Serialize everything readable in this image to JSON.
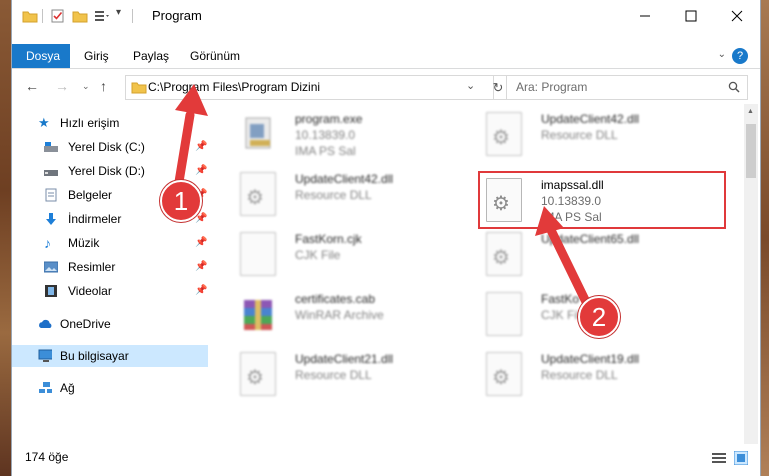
{
  "window": {
    "title": "Program"
  },
  "ribbon": {
    "tabs": [
      "Dosya",
      "Giriş",
      "Paylaş",
      "Görünüm"
    ]
  },
  "nav": {
    "address": "C:\\Program Files\\Program Dizini",
    "search_placeholder": "Ara: Program"
  },
  "sidebar": {
    "items": [
      {
        "label": "Hızlı erişim"
      },
      {
        "label": "Yerel Disk (C:)"
      },
      {
        "label": "Yerel Disk (D:)"
      },
      {
        "label": "Belgeler"
      },
      {
        "label": "İndirmeler"
      },
      {
        "label": "Müzik"
      },
      {
        "label": "Resimler"
      },
      {
        "label": "Videolar"
      },
      {
        "label": "OneDrive"
      },
      {
        "label": "Bu bilgisayar"
      },
      {
        "label": "Ağ"
      }
    ]
  },
  "files": [
    {
      "name": "program.exe",
      "line2": "10.13839.0",
      "line3": "IMA PS Sal"
    },
    {
      "name": "UpdateClient42.dll",
      "line2": "Resource DLL",
      "line3": ""
    },
    {
      "name": "UpdateClient42.dll",
      "line2": "Resource DLL",
      "line3": ""
    },
    {
      "name": "imapssal.dll",
      "line2": "10.13839.0",
      "line3": "IMA PS Sal"
    },
    {
      "name": "FastKorn.cjk",
      "line2": "CJK File",
      "line3": ""
    },
    {
      "name": "UpdateClient65.dll",
      "line2": "",
      "line3": ""
    },
    {
      "name": "certificates.cab",
      "line2": "WinRAR Archive",
      "line3": ""
    },
    {
      "name": "FastKo",
      "line2": "CJK Fil",
      "line3": ""
    },
    {
      "name": "UpdateClient21.dll",
      "line2": "Resource DLL",
      "line3": ""
    },
    {
      "name": "UpdateClient19.dll",
      "line2": "Resource DLL",
      "line3": ""
    }
  ],
  "status": {
    "count": "174 öğe"
  },
  "callouts": {
    "one": "1",
    "two": "2"
  },
  "colors": {
    "accent": "#1979ca",
    "callout": "#e23a3a",
    "selection": "#cce8ff"
  }
}
